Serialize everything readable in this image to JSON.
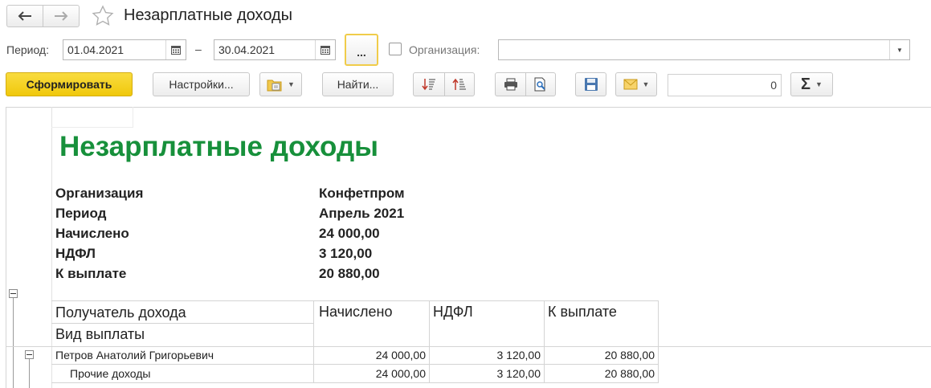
{
  "window": {
    "title": "Незарплатные доходы"
  },
  "filters": {
    "period_label": "Период:",
    "date_from": "01.04.2021",
    "dash": "–",
    "date_to": "30.04.2021",
    "more_label": "...",
    "org_label": "Организация:",
    "org_value": ""
  },
  "toolbar": {
    "generate_label": "Сформировать",
    "settings_label": "Настройки...",
    "find_label": "Найти...",
    "sum_value": "0"
  },
  "report": {
    "title": "Незарплатные доходы",
    "info": [
      {
        "label": "Организация",
        "value": "Конфетпром"
      },
      {
        "label": "Период",
        "value": "Апрель 2021"
      },
      {
        "label": "Начислено",
        "value": "24 000,00"
      },
      {
        "label": "НДФЛ",
        "value": "3 120,00"
      },
      {
        "label": "К выплате",
        "value": "20 880,00"
      }
    ],
    "columns": {
      "recipient": "Получатель дохода",
      "payment_type": "Вид выплаты",
      "accrued": "Начислено",
      "ndfl": "НДФЛ",
      "to_pay": "К выплате"
    },
    "rows": [
      {
        "name": "Петров Анатолий Григорьевич",
        "accrued": "24 000,00",
        "ndfl": "3 120,00",
        "to_pay": "20 880,00"
      },
      {
        "name": "Прочие доходы",
        "accrued": "24 000,00",
        "ndfl": "3 120,00",
        "to_pay": "20 880,00"
      }
    ]
  },
  "colors": {
    "accent_yellow": "#f5d020",
    "title_green": "#17903b"
  }
}
